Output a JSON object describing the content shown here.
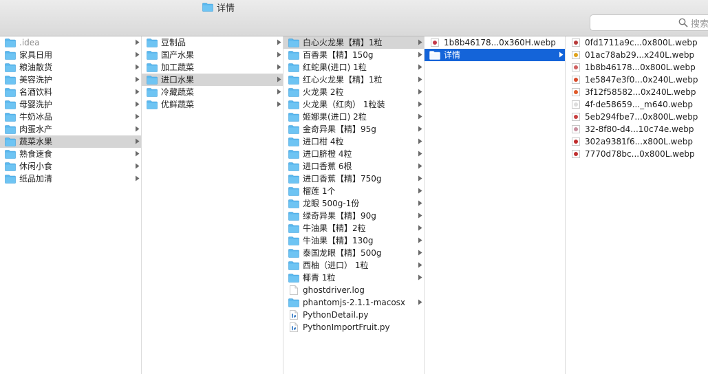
{
  "window": {
    "title": "详情"
  },
  "search": {
    "placeholder": "搜索"
  },
  "colors": {
    "folder": "#5ab8ee",
    "selection_blue": "#1464d9",
    "selection_gray": "#d5d5d5"
  },
  "columns": [
    {
      "items": [
        {
          "label": ".idea",
          "type": "folder",
          "dim": true
        },
        {
          "label": "家具日用",
          "type": "folder"
        },
        {
          "label": "粮油散货",
          "type": "folder"
        },
        {
          "label": "美容洗护",
          "type": "folder"
        },
        {
          "label": "名酒饮料",
          "type": "folder"
        },
        {
          "label": "母婴洗护",
          "type": "folder"
        },
        {
          "label": "牛奶冰品",
          "type": "folder"
        },
        {
          "label": "肉蛋水产",
          "type": "folder"
        },
        {
          "label": "蔬菜水果",
          "type": "folder",
          "selected": "gray"
        },
        {
          "label": "熟食速食",
          "type": "folder"
        },
        {
          "label": "休闲小食",
          "type": "folder"
        },
        {
          "label": "纸品加清",
          "type": "folder"
        }
      ]
    },
    {
      "items": [
        {
          "label": "豆制品",
          "type": "folder"
        },
        {
          "label": "国产水果",
          "type": "folder"
        },
        {
          "label": "加工蔬菜",
          "type": "folder"
        },
        {
          "label": "进口水果",
          "type": "folder",
          "selected": "gray"
        },
        {
          "label": "冷藏蔬菜",
          "type": "folder"
        },
        {
          "label": "优鲜蔬菜",
          "type": "folder"
        }
      ]
    },
    {
      "items": [
        {
          "label": "白心火龙果【精】1粒",
          "type": "folder",
          "selected": "gray"
        },
        {
          "label": "百香果【精】150g",
          "type": "folder"
        },
        {
          "label": "红蛇果(进口) 1粒",
          "type": "folder"
        },
        {
          "label": "红心火龙果【精】1粒",
          "type": "folder"
        },
        {
          "label": "火龙果 2粒",
          "type": "folder"
        },
        {
          "label": "火龙果（红肉） 1粒装",
          "type": "folder"
        },
        {
          "label": "姬娜果(进口) 2粒",
          "type": "folder"
        },
        {
          "label": "金奇异果【精】95g",
          "type": "folder"
        },
        {
          "label": "进口柑 4粒",
          "type": "folder"
        },
        {
          "label": "进口脐橙 4粒",
          "type": "folder"
        },
        {
          "label": "进口香蕉 6根",
          "type": "folder"
        },
        {
          "label": "进口香蕉【精】750g",
          "type": "folder"
        },
        {
          "label": "榴莲 1个",
          "type": "folder"
        },
        {
          "label": "龙眼 500g-1份",
          "type": "folder"
        },
        {
          "label": "绿奇异果【精】90g",
          "type": "folder"
        },
        {
          "label": "牛油果【精】2粒",
          "type": "folder"
        },
        {
          "label": "牛油果【精】130g",
          "type": "folder"
        },
        {
          "label": "泰国龙眼【精】500g",
          "type": "folder"
        },
        {
          "label": "西柚（进口） 1粒",
          "type": "folder"
        },
        {
          "label": "椰青 1粒",
          "type": "folder"
        },
        {
          "label": "ghostdriver.log",
          "type": "file"
        },
        {
          "label": "phantomjs-2.1.1-macosx",
          "type": "folder"
        },
        {
          "label": "PythonDetail.py",
          "type": "py"
        },
        {
          "label": "PythonImportFruit.py",
          "type": "py"
        }
      ]
    },
    {
      "items": [
        {
          "label": "1b8b46178...0x360H.webp",
          "type": "image",
          "tint": "#c4394a"
        },
        {
          "label": "详情",
          "type": "folder",
          "selected": "blue"
        }
      ]
    },
    {
      "items": [
        {
          "label": "0fd1711a9c...0x800L.webp",
          "type": "image",
          "tint": "#b83a3a"
        },
        {
          "label": "01ac78ab29...x240L.webp",
          "type": "image",
          "tint": "#e0a21a"
        },
        {
          "label": "1b8b46178...0x800L.webp",
          "type": "image",
          "tint": "#d06060"
        },
        {
          "label": "1e5847e3f0...0x240L.webp",
          "type": "image",
          "tint": "#d84a2a"
        },
        {
          "label": "3f12f58582...0x240L.webp",
          "type": "image",
          "tint": "#e05a2a"
        },
        {
          "label": "4f-de58659..._m640.webp",
          "type": "image",
          "tint": "#dddddd"
        },
        {
          "label": "5eb294fbe7...0x800L.webp",
          "type": "image",
          "tint": "#c84040"
        },
        {
          "label": "32-8f80-d4...10c74e.webp",
          "type": "image",
          "tint": "#c890a0"
        },
        {
          "label": "302a9381f6...x800L.webp",
          "type": "image",
          "tint": "#c02a2a"
        },
        {
          "label": "7770d78bc...0x800L.webp",
          "type": "image",
          "tint": "#c03030"
        }
      ]
    }
  ]
}
